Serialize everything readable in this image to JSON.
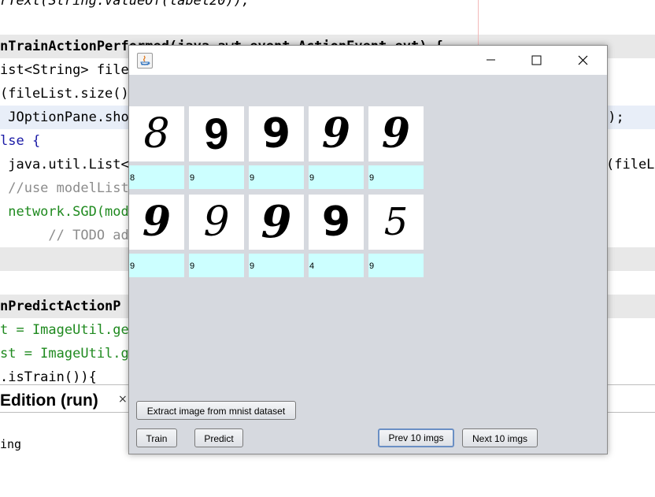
{
  "ide": {
    "lines": [
      "rText(String.valueOf(label20));",
      "nTrainActionPerformed(java.awt.event.ActionEvent evt) {",
      "ist<String> fileL",
      "(fileList.size()",
      " JOptionPane.show",
      "lse {",
      " java.util.List<L",
      " //use modelList",
      " network.SGD(mode",
      "      // TODO add",
      "nPredictActionP",
      "t = ImageUtil.get",
      "st = ImageUtil.ge",
      ".isTrain()){"
    ],
    "right_fragments": [
      "\");",
      "(fileLi"
    ],
    "output_tab_title": "Edition (run)",
    "output_tab_close": "×",
    "output_text": "ing"
  },
  "window": {
    "title": "",
    "min_glyph": "─",
    "max_glyph": "☐",
    "close_glyph": "✕"
  },
  "images": [
    {
      "digit": "8",
      "label": "8"
    },
    {
      "digit": "9",
      "label": "9"
    },
    {
      "digit": "9",
      "label": "9"
    },
    {
      "digit": "9",
      "label": "9"
    },
    {
      "digit": "9",
      "label": "9"
    },
    {
      "digit": "9",
      "label": "9"
    },
    {
      "digit": "9",
      "label": "9"
    },
    {
      "digit": "9",
      "label": "9"
    },
    {
      "digit": "9",
      "label": "4"
    },
    {
      "digit": "5",
      "label": "9"
    }
  ],
  "buttons": {
    "extract": "Extract image from mnist dataset",
    "train": "Train",
    "predict": "Predict",
    "prev": "Prev 10 imgs",
    "next": "Next 10 imgs"
  }
}
